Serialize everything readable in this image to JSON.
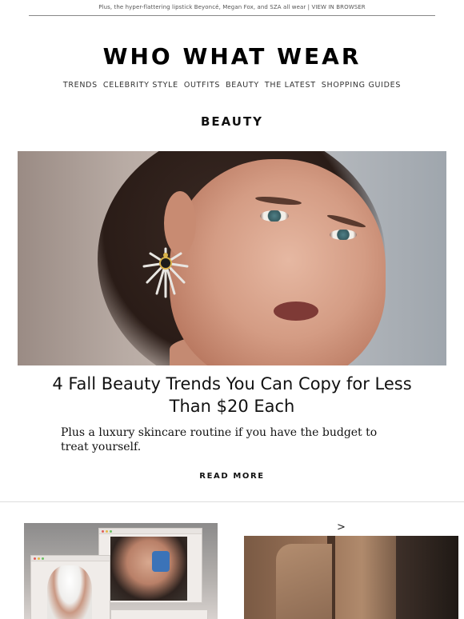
{
  "preheader": "Plus, the hyper-flattering lipstick Beyoncé, Megan Fox, and SZA all wear | VIEW IN BROWSER",
  "logo": "WHO WHAT WEAR",
  "nav": [
    "TRENDS",
    "CELEBRITY STYLE",
    "OUTFITS",
    "BEAUTY",
    "THE LATEST",
    "SHOPPING GUIDES"
  ],
  "section_title": "BEAUTY",
  "hero": {
    "headline": "4 Fall Beauty Trends You Can Copy for Less Than $20 Each",
    "dek": "Plus a luxury skincare routine if you have the budget to treat yourself.",
    "cta": "READ MORE"
  },
  "next_arrow": ">",
  "colors": {
    "text": "#111111",
    "rule": "#888888",
    "background": "#ffffff"
  }
}
